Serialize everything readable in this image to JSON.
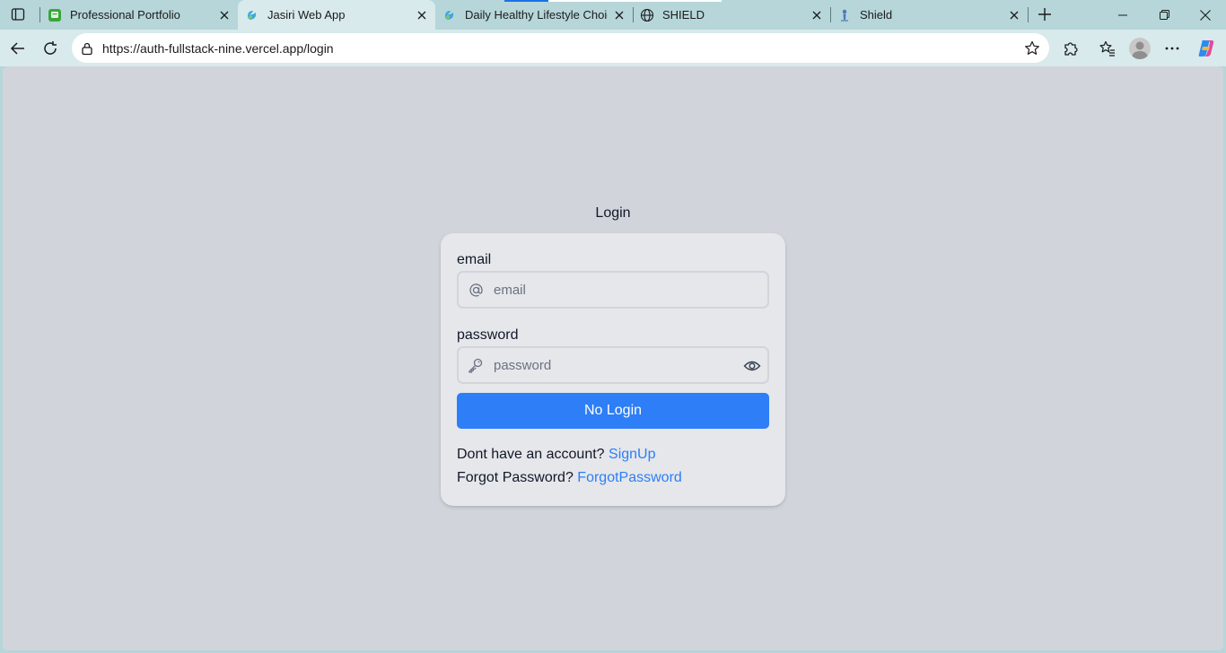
{
  "browser": {
    "tabs": [
      {
        "title": "Professional Portfolio",
        "favicon": "portfolio-icon",
        "active": false
      },
      {
        "title": "Jasiri Web App",
        "favicon": "jasiri-icon",
        "active": true
      },
      {
        "title": "Daily Healthy Lifestyle Choices",
        "favicon": "jasiri-icon",
        "active": false
      },
      {
        "title": "SHIELD",
        "favicon": "globe-icon",
        "active": false
      },
      {
        "title": "Shield",
        "favicon": "shield-icon",
        "active": false
      }
    ],
    "address": {
      "url": "https://auth-fullstack-nine.vercel.app/login"
    },
    "accent_color": "#2d7ef7"
  },
  "page": {
    "heading": "Login",
    "email": {
      "label": "email",
      "placeholder": "email",
      "value": ""
    },
    "password": {
      "label": "password",
      "placeholder": "password",
      "value": ""
    },
    "submit_label": "No Login",
    "signup_prompt": "Dont have an account?",
    "signup_link": "SignUp",
    "forgot_prompt": "Forgot Password?",
    "forgot_link": "ForgotPassword",
    "colors": {
      "background": "#d1d5db",
      "card": "#e5e7eb",
      "button": "#2d7ef7",
      "link": "#2d7ef7"
    }
  }
}
